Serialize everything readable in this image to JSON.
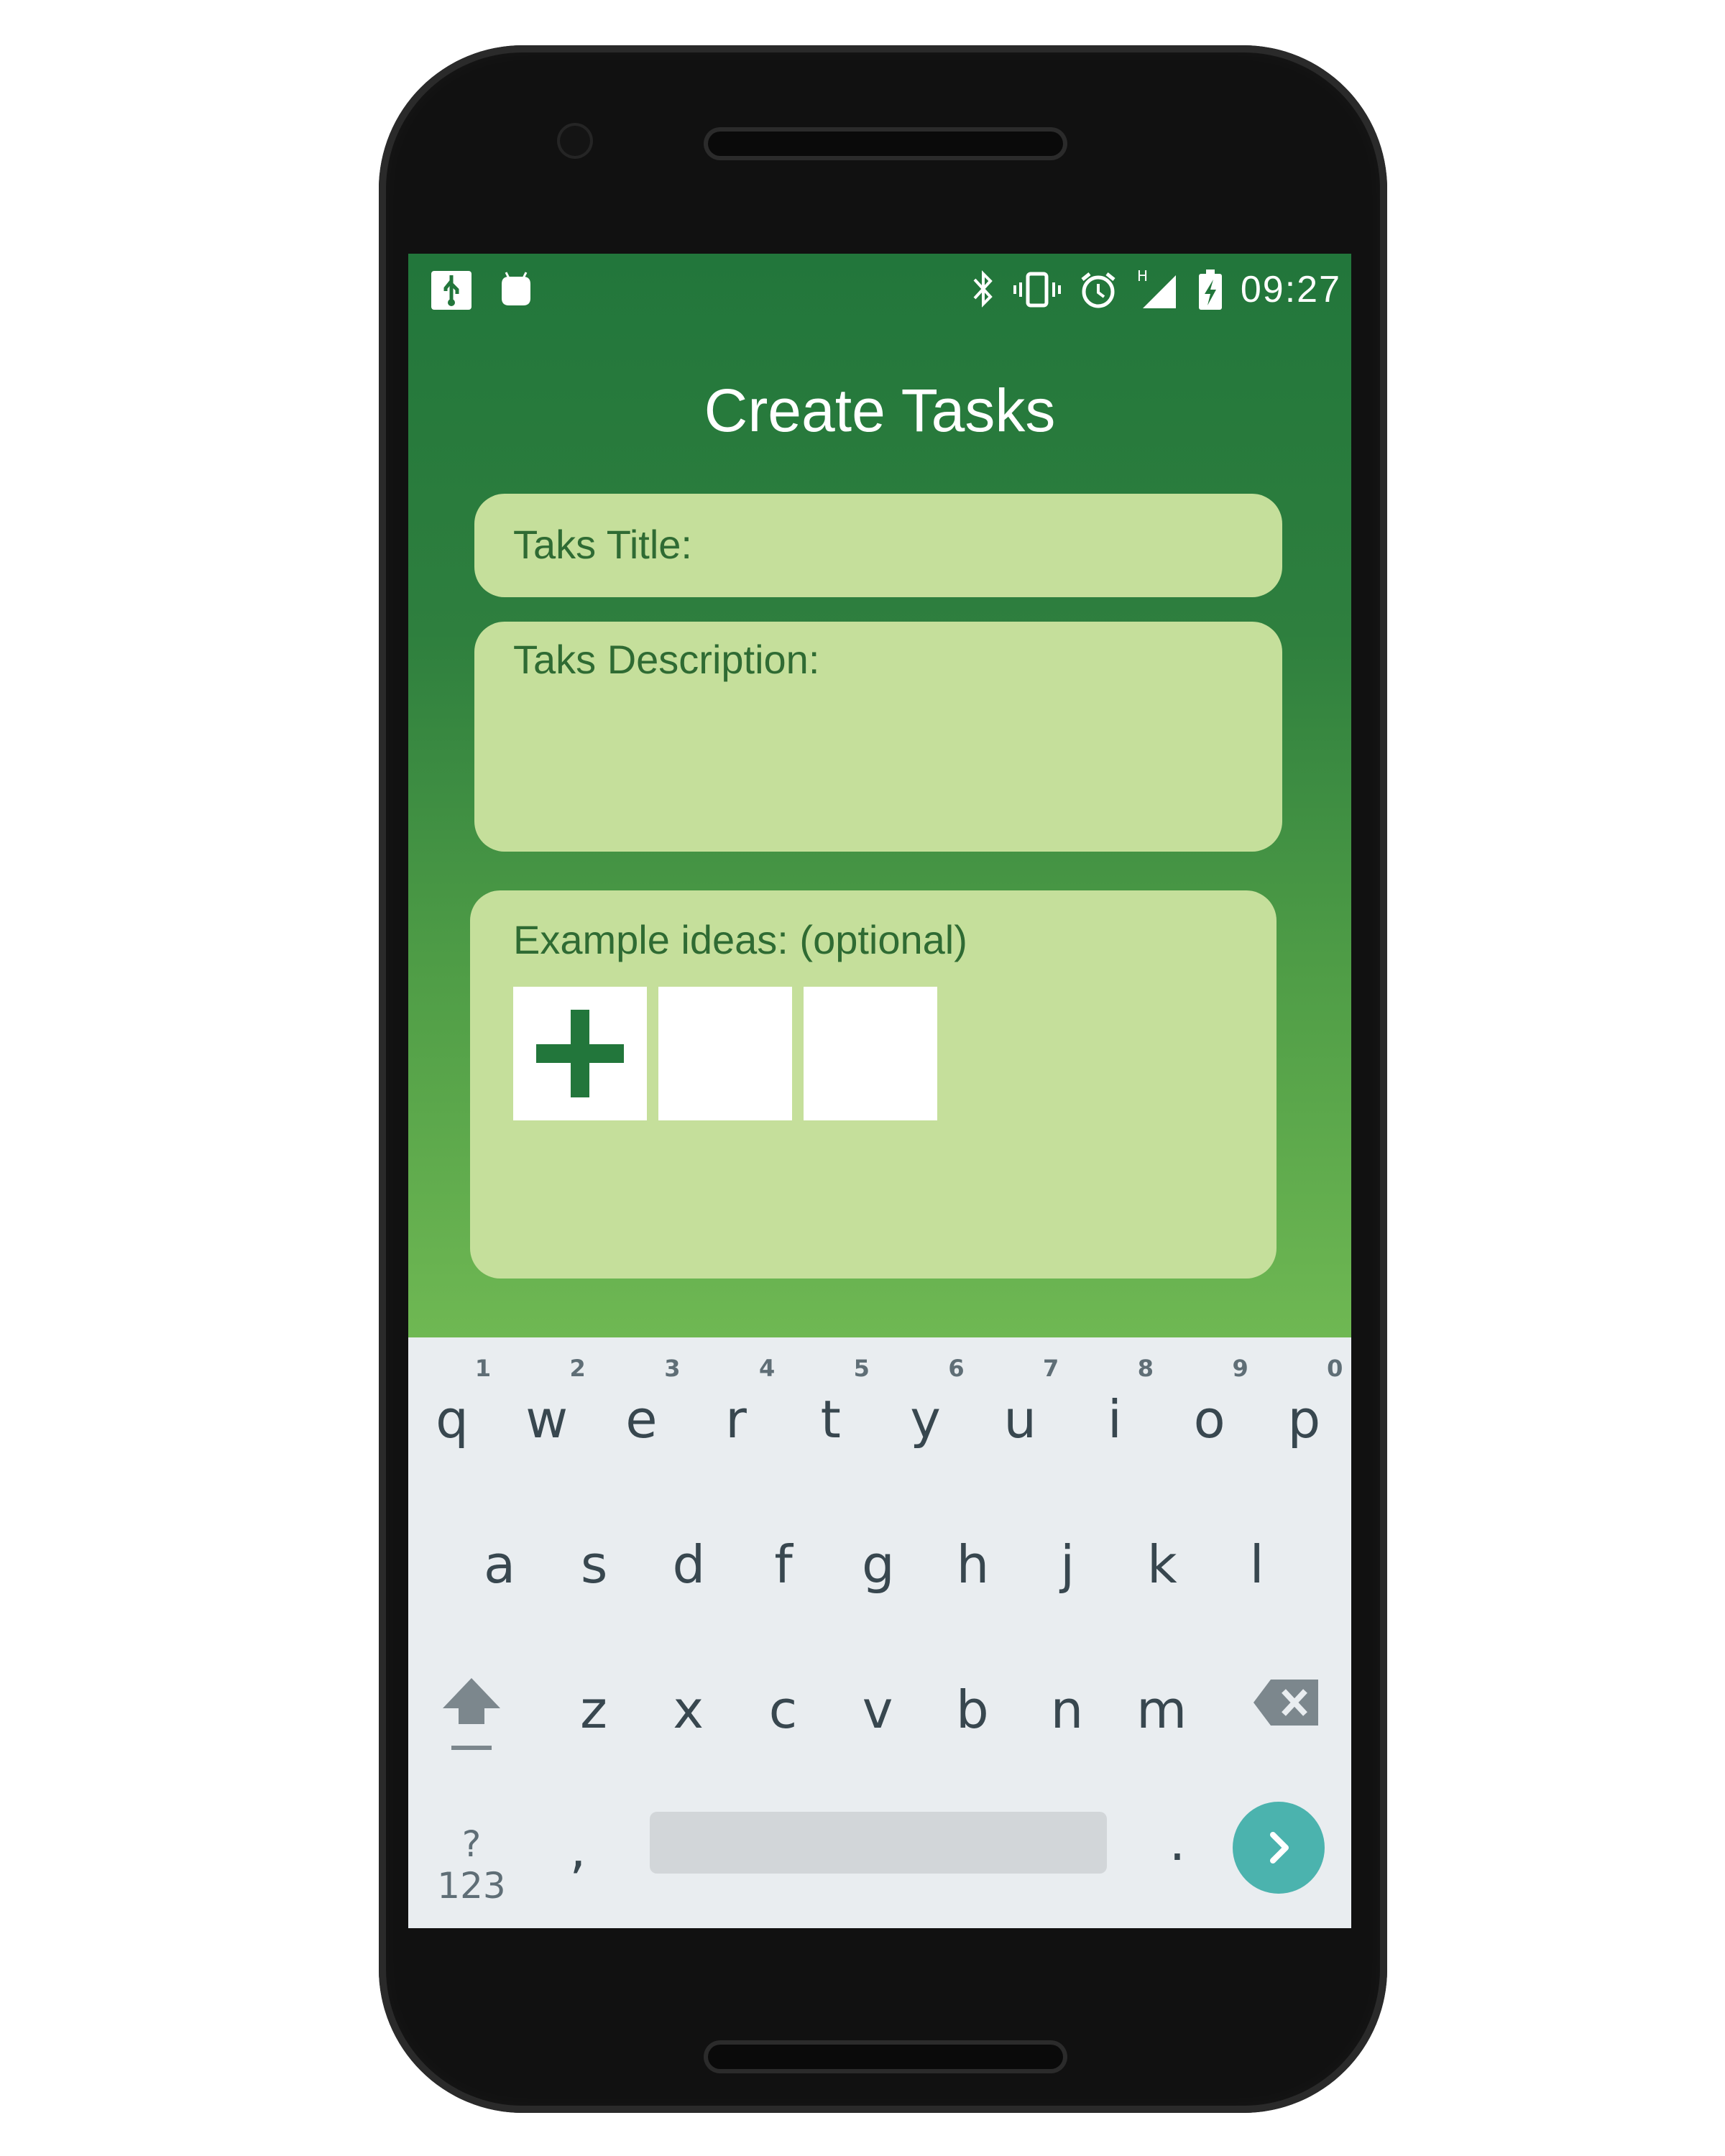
{
  "status_bar": {
    "time": "09:27",
    "icons": [
      "usb-icon",
      "android-notification-icon",
      "bluetooth-icon",
      "vibrate-icon",
      "alarm-icon",
      "signal-h-icon",
      "battery-charging-icon"
    ],
    "network_type": "H"
  },
  "screen": {
    "title": "Create Tasks",
    "title_field": {
      "placeholder": "Taks Title:"
    },
    "description_field": {
      "placeholder": "Taks Description:"
    },
    "examples": {
      "label": "Example ideas: (optional)",
      "add_icon": "plus-icon",
      "slots": 2
    }
  },
  "keyboard": {
    "row1": [
      {
        "k": "q",
        "h": "1"
      },
      {
        "k": "w",
        "h": "2"
      },
      {
        "k": "e",
        "h": "3"
      },
      {
        "k": "r",
        "h": "4"
      },
      {
        "k": "t",
        "h": "5"
      },
      {
        "k": "y",
        "h": "6"
      },
      {
        "k": "u",
        "h": "7"
      },
      {
        "k": "i",
        "h": "8"
      },
      {
        "k": "o",
        "h": "9"
      },
      {
        "k": "p",
        "h": "0"
      }
    ],
    "row2": [
      "a",
      "s",
      "d",
      "f",
      "g",
      "h",
      "j",
      "k",
      "l"
    ],
    "row3": [
      "z",
      "x",
      "c",
      "v",
      "b",
      "n",
      "m"
    ],
    "symbols_key": "?123",
    "comma_key": ",",
    "period_key": ".",
    "shift_icon": "shift-arrow-icon",
    "backspace_icon": "backspace-icon",
    "enter_icon": "chevron-right-icon",
    "colors": {
      "enter": "#4bb3ae",
      "app_green": "#22763b",
      "field": "#c5df9b"
    }
  }
}
